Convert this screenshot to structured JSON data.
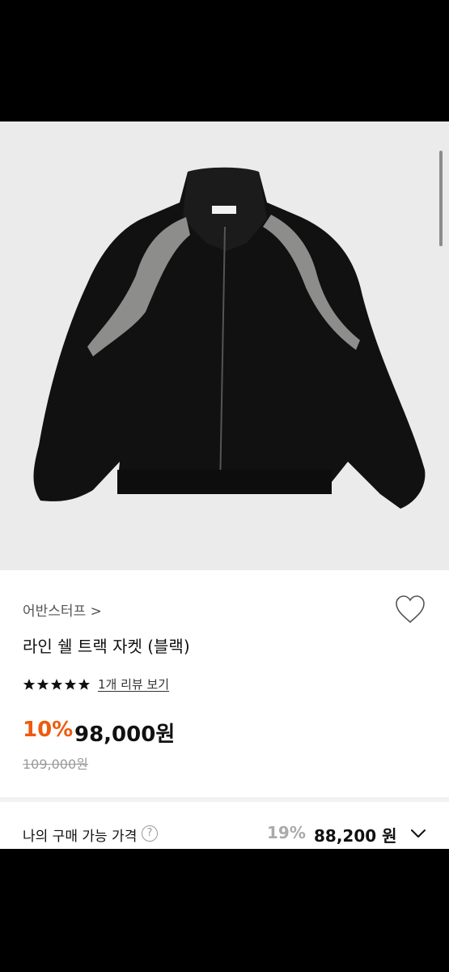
{
  "product": {
    "brand": "어반스터프 >",
    "title": "라인 쉘 트랙 자켓 (블랙)",
    "rating_stars": 5,
    "review_link": "1개 리뷰 보기",
    "discount": "10%",
    "price": "98,000원",
    "original_price": "109,000원"
  },
  "purchase": {
    "label": "나의 구매 가능 가격",
    "help_icon": "?",
    "discount": "19%",
    "price": "88,200 원"
  },
  "icons": {
    "heart": "heart-outline-icon",
    "star": "star-filled-icon",
    "chevron": "chevron-down-icon"
  },
  "colors": {
    "discount_orange": "#ee5a0d",
    "photo_background": "#ebebeb"
  }
}
